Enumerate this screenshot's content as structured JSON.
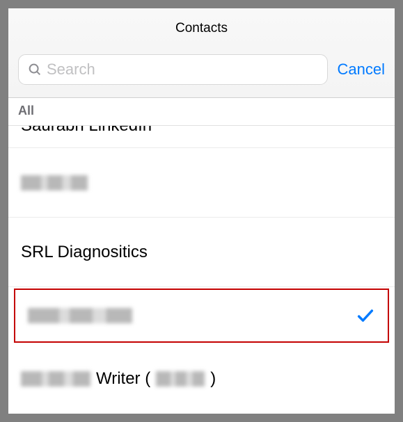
{
  "header": {
    "title": "Contacts",
    "search_placeholder": "Search",
    "cancel_label": "Cancel"
  },
  "filter": {
    "all_label": "All"
  },
  "colors": {
    "accent": "#007aff",
    "highlight_border": "#c40000"
  },
  "contacts": [
    {
      "name": "Saurabh LinkedIn",
      "redacted": false,
      "selected": false,
      "cut_top": true
    },
    {
      "name": "",
      "redacted": true,
      "selected": false,
      "redact_width": 96
    },
    {
      "name": "SRL Diagnositics",
      "redacted": false,
      "selected": false
    },
    {
      "name": "",
      "redacted": true,
      "selected": true,
      "redact_width": 150
    },
    {
      "name_parts": {
        "before_redact_width": 100,
        "text_mid": "Writer (",
        "inner_redact_width": 70,
        "text_end": ")"
      },
      "redacted": false,
      "selected": false,
      "composite": true
    }
  ]
}
